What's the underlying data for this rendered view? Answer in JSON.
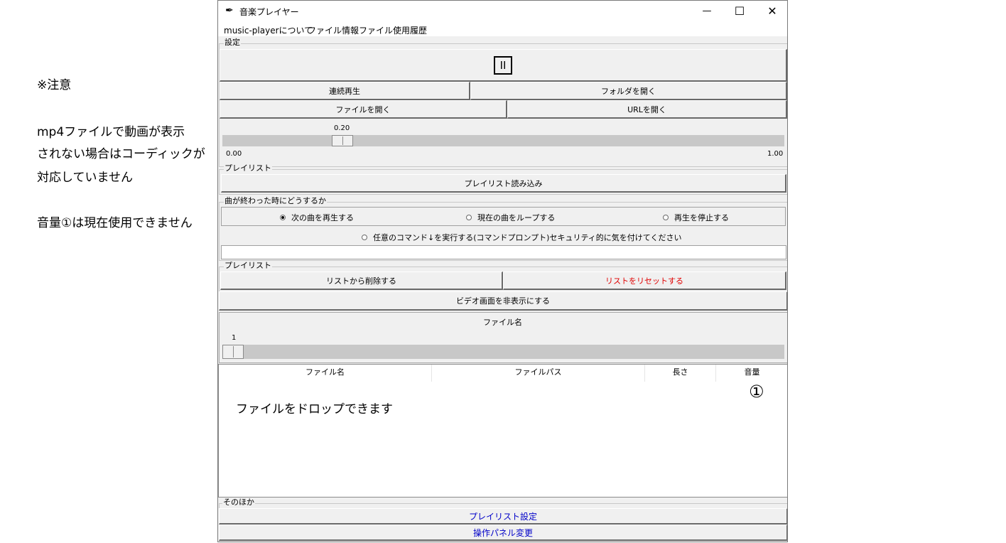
{
  "notes": {
    "line1": "※注意",
    "line2": "mp4ファイルで動画が表示",
    "line3": "されない場合はコーディックが",
    "line4": "対応していません",
    "line5": "音量①は現在使用できません"
  },
  "window": {
    "title": "音楽プレイヤー",
    "minimize": "—",
    "maximize": "☐",
    "close": "✕"
  },
  "menu": {
    "about": "music-playerについて",
    "file_info": "ファイル情報",
    "history": "ファイル使用履歴"
  },
  "settings": {
    "label": "設定",
    "play_pause": "II",
    "continuous": "連続再生",
    "open_folder": "フォルダを開く",
    "open_file": "ファイルを開く",
    "open_url": "URLを開く",
    "volume_value": "0.20",
    "volume_min": "0.00",
    "volume_max": "1.00",
    "volume_level": 0.2
  },
  "playlist1": {
    "label": "プレイリスト",
    "load": "プレイリスト読み込み"
  },
  "on_end": {
    "label": "曲が終わった時にどうするか",
    "options": [
      {
        "label": "次の曲を再生する",
        "selected": true
      },
      {
        "label": "現在の曲をループする",
        "selected": false
      },
      {
        "label": "再生を停止する",
        "selected": false
      },
      {
        "label": "任意のコマンド↓を実行する(コマンドプロンプト)セキュリティ的に気を付けてください",
        "selected": false
      }
    ],
    "command_value": ""
  },
  "playlist2": {
    "label": "プレイリスト",
    "remove": "リストから削除する",
    "reset": "リストをリセットする",
    "reset_color": "#e00000",
    "hide_video": "ビデオ画面を非表示にする"
  },
  "position": {
    "filename_label": "ファイル名",
    "value": "1"
  },
  "table": {
    "columns": [
      "ファイル名",
      "ファイルパス",
      "長さ",
      "音量"
    ],
    "volume_marker": "①",
    "drop_hint": "ファイルをドロップできます"
  },
  "other": {
    "label": "そのほか",
    "playlist_settings": "プレイリスト設定",
    "panel_change": "操作パネル変更",
    "link_color": "#0000c8"
  }
}
